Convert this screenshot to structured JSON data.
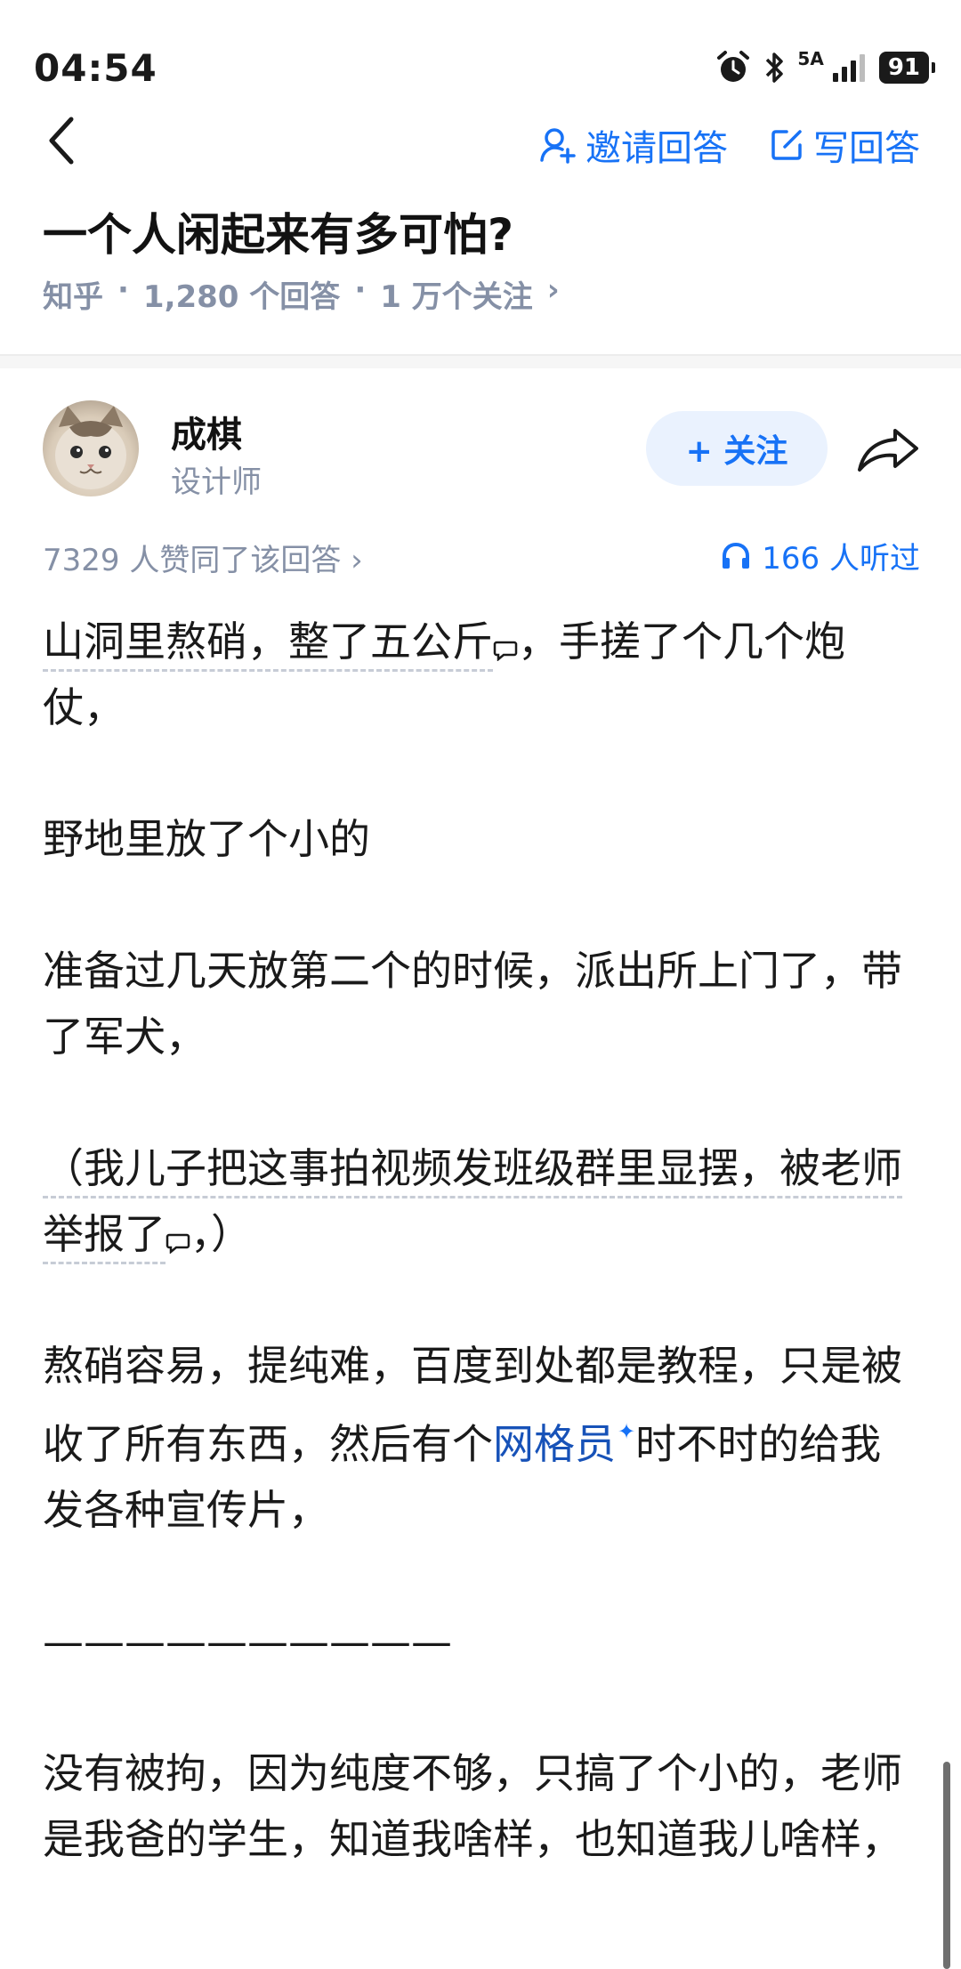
{
  "status_bar": {
    "time": "04:54",
    "signal_label": "5A",
    "battery": "91"
  },
  "header": {
    "invite_label": "邀请回答",
    "write_label": "写回答"
  },
  "question": {
    "title": "一个人闲起来有多可怕?",
    "source": "知乎",
    "answer_count": "1,280 个回答",
    "follower_count": "1 万个关注",
    "separator": "·",
    "chevron": "›"
  },
  "author": {
    "name": "成棋",
    "title": "设计师",
    "follow_label": "+ 关注"
  },
  "stats": {
    "likes_text": "7329 人赞同了该回答 ›",
    "listen_text": "166 人听过"
  },
  "answer": {
    "p1a": "山洞里熬硝，整了五公斤",
    "p1b": "，手搓了个几个炮仗，",
    "p2": "野地里放了个小的",
    "p3": "准备过几天放第二个的时候，派出所上门了，带了军犬，",
    "p4a": "（我儿子把这事拍视频发班级群里显摆，被老师举报了",
    "p4b": "，）",
    "p5a": "熬硝容易，提纯难，百度到处都是教程，只是被收了所有东西，然后有个",
    "p5_link": "网格员",
    "p5b": "时不时的给我发各种宣传片，",
    "p6": "——————————",
    "p7": "没有被拘，因为纯度不够，只搞了个小的，老师是我爸的学生，知道我啥样，也知道我儿啥样，"
  },
  "colors": {
    "accent": "#1772f6",
    "meta_gray": "#8590a6",
    "link": "#1752b8"
  },
  "icons": [
    "alarm-icon",
    "bluetooth-icon",
    "signal-icon",
    "battery-icon",
    "back-icon",
    "invite-icon",
    "write-icon",
    "share-icon",
    "headphones-icon",
    "comment-icon"
  ]
}
